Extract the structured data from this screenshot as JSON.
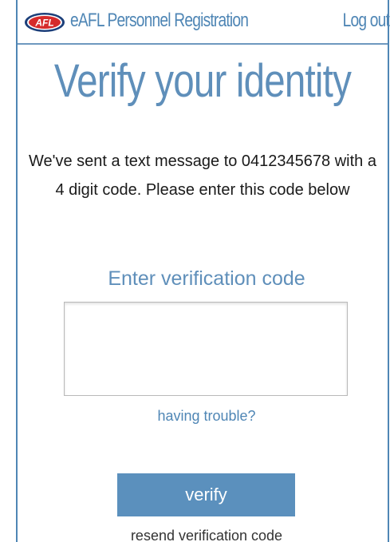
{
  "header": {
    "logo_text": "AFL",
    "app_title": "eAFL Personnel Registration",
    "logout_label": "Log out"
  },
  "main": {
    "title": "Verify your identity",
    "message": "We've sent a text message to 0412345678 with a 4 digit code. Please enter this code below",
    "code_label": "Enter verification code",
    "code_value": "",
    "trouble_link": "having trouble?",
    "verify_label": "verify",
    "resend_link": "resend verification code"
  },
  "colors": {
    "accent": "#5b90bd",
    "logo_red": "#d52b2b",
    "logo_navy": "#1c3f7a"
  },
  "icons": {
    "logo": "afl-logo-icon"
  }
}
